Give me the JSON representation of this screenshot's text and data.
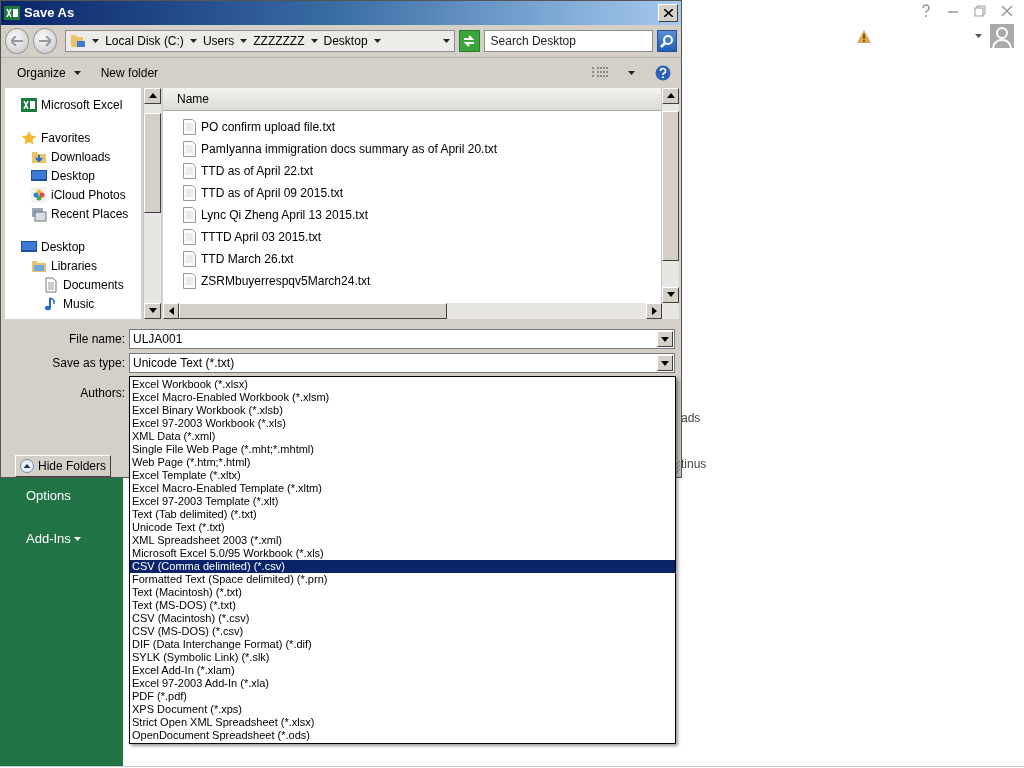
{
  "backstage": {
    "nav_items": [
      {
        "label": "Options",
        "menu": false
      },
      {
        "label": "Add-Ins",
        "menu": true
      }
    ],
    "content_fragments": [
      "ads",
      "tinus"
    ]
  },
  "dialog": {
    "title": "Save As",
    "breadcrumb": [
      "Local Disk (C:)",
      "Users",
      "ZZZZZZZ",
      "Desktop"
    ],
    "search": {
      "placeholder": "Search Desktop"
    },
    "toolbar": {
      "organize": "Organize",
      "new_folder": "New folder"
    },
    "nav_tree": [
      {
        "label": "Microsoft Excel",
        "kind": "excel"
      },
      {
        "label": "Favorites",
        "kind": "star",
        "children": [
          {
            "label": "Downloads",
            "kind": "downloads"
          },
          {
            "label": "Desktop",
            "kind": "desktop"
          },
          {
            "label": "iCloud Photos",
            "kind": "photos"
          },
          {
            "label": "Recent Places",
            "kind": "recent"
          }
        ]
      },
      {
        "label": "Desktop",
        "kind": "desktop",
        "children": [
          {
            "label": "Libraries",
            "kind": "libraries",
            "children": [
              {
                "label": "Documents",
                "kind": "documents"
              },
              {
                "label": "Music",
                "kind": "music"
              }
            ]
          }
        ]
      }
    ],
    "file_list": {
      "column": "Name",
      "files": [
        "PO confirm upload file.txt",
        "PamIyanna immigration docs summary as of April 20.txt",
        "TTD as of April 22.txt",
        "TTD as of April 09 2015.txt",
        "Lync Qi Zheng April 13 2015.txt",
        "TTTD April 03 2015.txt",
        "TTD March 26.txt",
        "ZSRMbuyerrespqv5March24.txt"
      ]
    },
    "form": {
      "file_name_label": "File name:",
      "file_name": "ULJA001",
      "type_label": "Save as type:",
      "type_value": "Unicode Text (*.txt)",
      "authors_label": "Authors:"
    },
    "hide_folders": "Hide Folders"
  },
  "type_menu": {
    "options": [
      {
        "label": "Excel Workbook (*.xlsx)",
        "selected": false
      },
      {
        "label": "Excel Macro-Enabled Workbook (*.xlsm)",
        "selected": false
      },
      {
        "label": "Excel Binary Workbook (*.xlsb)",
        "selected": false
      },
      {
        "label": "Excel 97-2003 Workbook (*.xls)",
        "selected": false
      },
      {
        "label": "XML Data (*.xml)",
        "selected": false
      },
      {
        "label": "Single File Web Page (*.mht;*.mhtml)",
        "selected": false
      },
      {
        "label": "Web Page (*.htm;*.html)",
        "selected": false
      },
      {
        "label": "Excel Template (*.xltx)",
        "selected": false
      },
      {
        "label": "Excel Macro-Enabled Template (*.xltm)",
        "selected": false
      },
      {
        "label": "Excel 97-2003 Template (*.xlt)",
        "selected": false
      },
      {
        "label": "Text (Tab delimited) (*.txt)",
        "selected": false
      },
      {
        "label": "Unicode Text (*.txt)",
        "selected": false
      },
      {
        "label": "XML Spreadsheet 2003 (*.xml)",
        "selected": false
      },
      {
        "label": "Microsoft Excel 5.0/95 Workbook (*.xls)",
        "selected": false
      },
      {
        "label": "CSV (Comma delimited) (*.csv)",
        "selected": true
      },
      {
        "label": "Formatted Text (Space delimited) (*.prn)",
        "selected": false
      },
      {
        "label": "Text (Macintosh) (*.txt)",
        "selected": false
      },
      {
        "label": "Text (MS-DOS) (*.txt)",
        "selected": false
      },
      {
        "label": "CSV (Macintosh) (*.csv)",
        "selected": false
      },
      {
        "label": "CSV (MS-DOS) (*.csv)",
        "selected": false
      },
      {
        "label": "DIF (Data Interchange Format) (*.dif)",
        "selected": false
      },
      {
        "label": "SYLK (Symbolic Link) (*.slk)",
        "selected": false
      },
      {
        "label": "Excel Add-In (*.xlam)",
        "selected": false
      },
      {
        "label": "Excel 97-2003 Add-In (*.xla)",
        "selected": false
      },
      {
        "label": "PDF (*.pdf)",
        "selected": false
      },
      {
        "label": "XPS Document (*.xps)",
        "selected": false
      },
      {
        "label": "Strict Open XML Spreadsheet (*.xlsx)",
        "selected": false
      },
      {
        "label": "OpenDocument Spreadsheet (*.ods)",
        "selected": false
      }
    ]
  }
}
